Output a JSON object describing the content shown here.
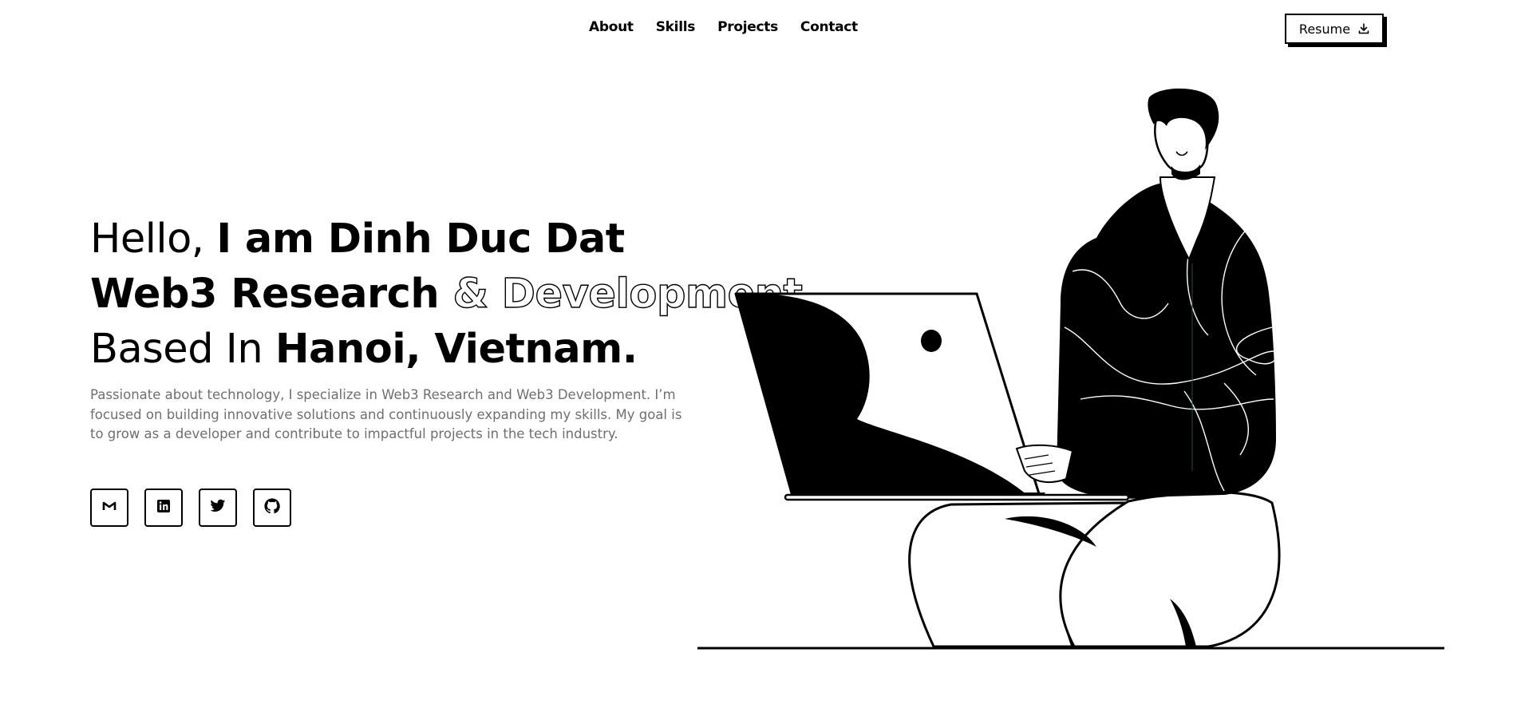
{
  "nav": {
    "items": [
      {
        "label": "About"
      },
      {
        "label": "Skills"
      },
      {
        "label": "Projects"
      },
      {
        "label": "Contact"
      }
    ],
    "resume_label": "Resume"
  },
  "hero": {
    "line1": {
      "light": "Hello, ",
      "bold": "I am Dinh Duc Dat"
    },
    "line2": {
      "bold": "Web3 Research ",
      "outline": "& Development"
    },
    "line3": {
      "light": "Based In ",
      "bold": "Hanoi, Vietnam."
    },
    "description": "Passionate about technology, I specialize in Web3 Research and Web3 Development. I’m focused on building innovative solutions and continuously expanding my skills. My goal is to grow as a developer and contribute to impactful projects in the tech industry."
  },
  "socials": [
    {
      "icon": "gmail-icon"
    },
    {
      "icon": "linkedin-icon"
    },
    {
      "icon": "twitter-icon"
    },
    {
      "icon": "github-icon"
    }
  ],
  "colors": {
    "text": "#000000",
    "muted": "#6e6e73",
    "background": "#ffffff"
  }
}
